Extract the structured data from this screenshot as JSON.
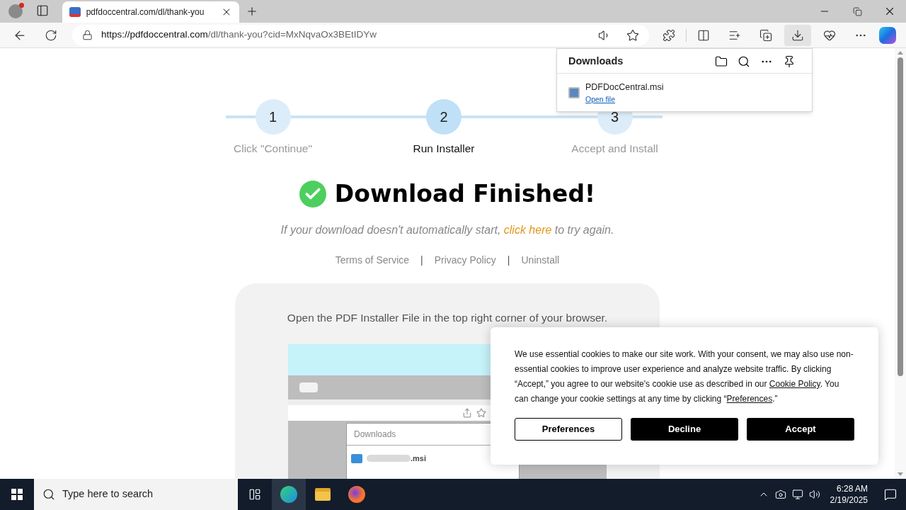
{
  "browser": {
    "tab": {
      "title": "pdfdoccentral.com/dl/thank-you",
      "selected": true
    },
    "url": {
      "host": "https://pdfdoccentral.com",
      "path": "/dl/thank-you?cid=MxNqvaOx3BEtIDYw"
    },
    "downloads_panel": {
      "title": "Downloads",
      "items": [
        {
          "name": "PDFDocCentral.msi",
          "action": "Open file"
        }
      ]
    }
  },
  "page": {
    "steps": [
      {
        "number": "1",
        "label": "Click \"Continue\"",
        "selected": false
      },
      {
        "number": "2",
        "label": "Run Installer",
        "selected": true
      },
      {
        "number": "3",
        "label": "Accept and Install",
        "selected": false
      }
    ],
    "heading": "Download Finished!",
    "note": {
      "before": "If your download doesn't automatically start, ",
      "link": "click here",
      "after": " to try again."
    },
    "footer_links": [
      {
        "label": "Terms of Service"
      },
      {
        "label": "Privacy Policy"
      },
      {
        "label": "Uninstall"
      }
    ],
    "separator": "|",
    "card": {
      "instruction": "Open the PDF Installer File in the top right corner of your browser.",
      "illustration": {
        "panel_title": "Downloads",
        "file_suffix": ".msi"
      }
    }
  },
  "cookie_banner": {
    "text_1": "We use essential cookies to make our site work. With your consent, we may also use non-essential cookies to improve user experience and analyze website traffic. By clicking “Accept,” you agree to our website's cookie use as described in our ",
    "link_1": "Cookie Policy",
    "text_2": ". You can change your cookie settings at any time by clicking “",
    "link_2": "Preferences",
    "text_3": ".”",
    "buttons": [
      {
        "label": "Preferences",
        "kind": "outline"
      },
      {
        "label": "Decline",
        "kind": "solid"
      },
      {
        "label": "Accept",
        "kind": "solid"
      }
    ]
  },
  "taskbar": {
    "search_placeholder": "Type here to search",
    "time": "6:28 AM",
    "date": "2/19/2025"
  }
}
